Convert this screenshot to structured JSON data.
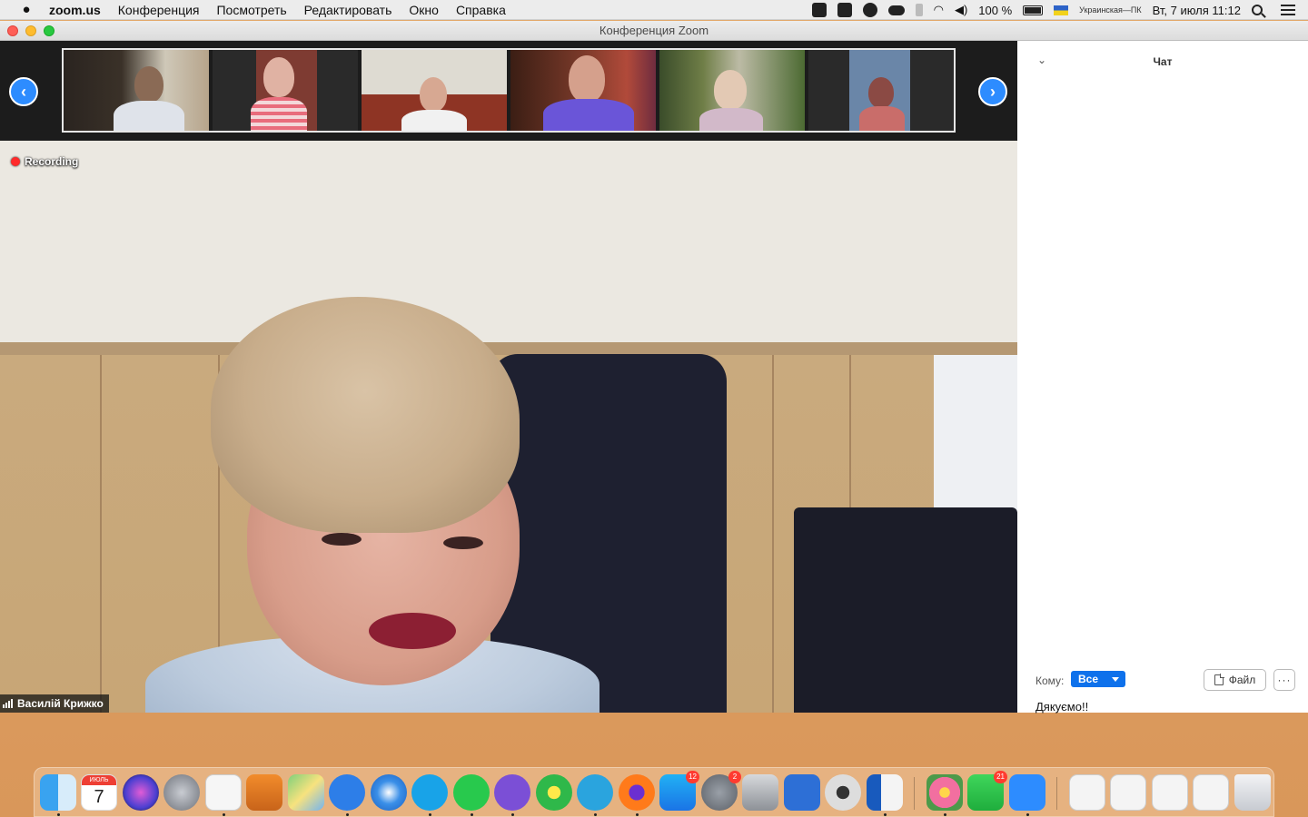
{
  "menubar": {
    "apple": "",
    "app_name": "zoom.us",
    "menus": [
      "Конференция",
      "Посмотреть",
      "Редактировать",
      "Окно",
      "Справка"
    ],
    "battery": "100 %",
    "keyboard_layout": "Украинская—ПК",
    "datetime": "Вт, 7 июля  11:12",
    "status_icons": [
      "zoom-icon",
      "camera-icon",
      "viber-icon",
      "cloud-icon",
      "bluetooth-icon",
      "wifi-icon",
      "volume-icon"
    ]
  },
  "window": {
    "title": "Конференция Zoom"
  },
  "gallery": {
    "prev_arrow": "‹",
    "next_arrow": "›"
  },
  "main_video": {
    "recording_label": "Recording",
    "speaker_name": "Василій Крижко"
  },
  "chat": {
    "collapse_glyph": "⌄",
    "title": "Чат",
    "to_label": "Кому:",
    "recipient": "Все",
    "file_button": "Файл",
    "more_button": "···",
    "input_text": "Дякуємо!!"
  },
  "dock": {
    "calendar_month": "ИЮЛЬ",
    "calendar_day": "7",
    "badges": {
      "app_store": "12",
      "system_preferences": "2",
      "facetime": "21"
    }
  },
  "colors": {
    "accent": "#2d8cff",
    "recipient": "#0e71eb",
    "record_dot": "#ff2a2a"
  }
}
